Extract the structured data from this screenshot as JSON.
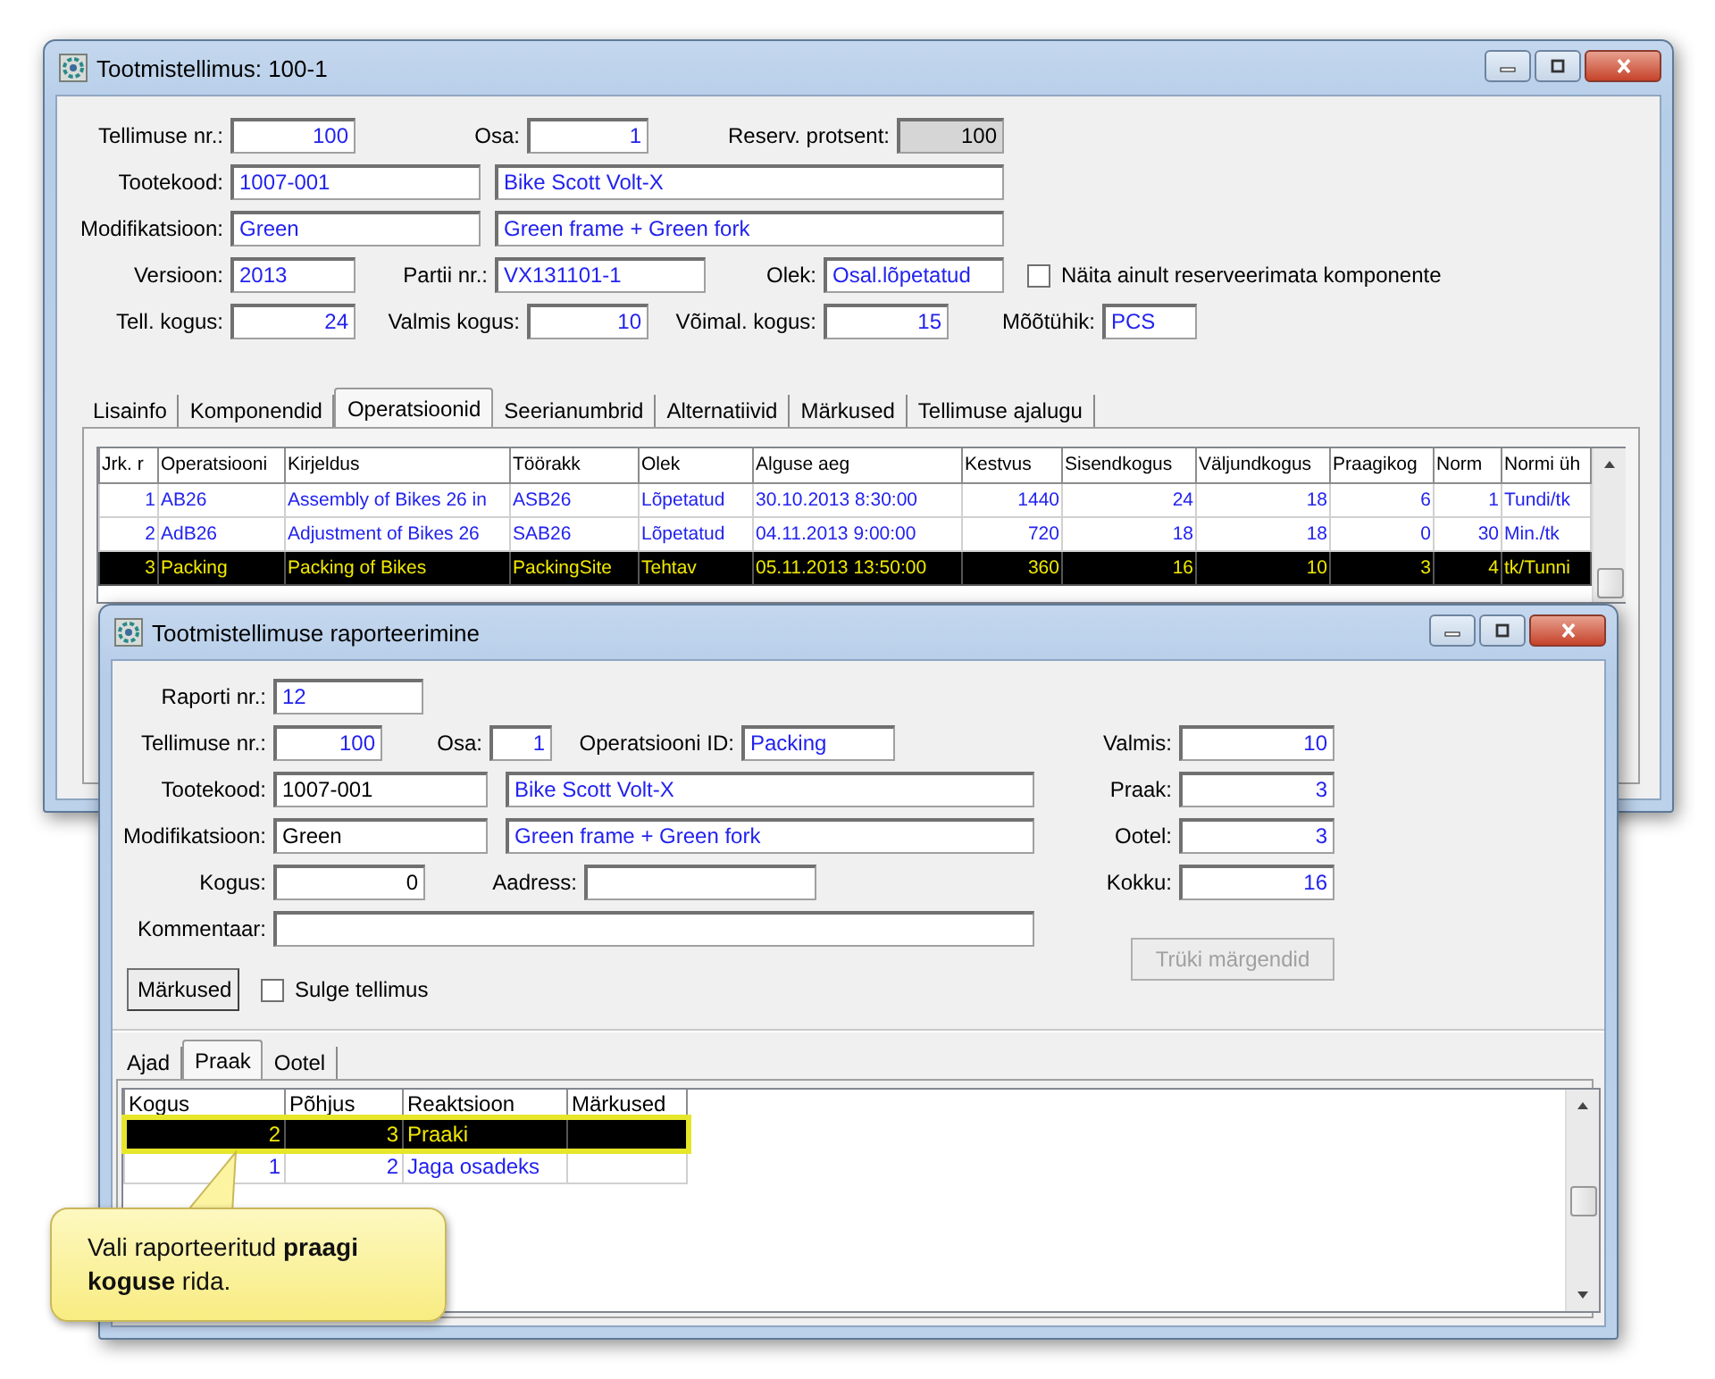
{
  "main_window": {
    "title": "Tootmistellimus: 100-1",
    "fields": [
      {
        "label": "Tellimuse nr.:",
        "value": "100",
        "kind": "lookup"
      },
      {
        "label": "Osa:",
        "value": "1",
        "kind": "lookup"
      },
      {
        "label": "Reserv. protsent:",
        "value": "100",
        "kind": "readonly"
      },
      {
        "label": "Tootekood:",
        "value": "1007-001",
        "kind": "lookup"
      },
      {
        "value": "Bike Scott Volt-X",
        "kind": "lookup"
      },
      {
        "label": "Modifikatsioon:",
        "value": "Green",
        "kind": "lookup"
      },
      {
        "value": "Green frame + Green fork",
        "kind": "lookup"
      },
      {
        "label": "Versioon:",
        "value": "2013",
        "kind": "lookup"
      },
      {
        "label": "Partii nr.:",
        "value": "VX131101-1",
        "kind": "lookup"
      },
      {
        "label": "Olek:",
        "value": "Osal.lõpetatud",
        "kind": "lookup"
      },
      {
        "label": "Tell. kogus:",
        "value": "24",
        "kind": "lookup"
      },
      {
        "label": "Valmis kogus:",
        "value": "10",
        "kind": "lookup"
      },
      {
        "label": "Võimal. kogus:",
        "value": "15",
        "kind": "lookup"
      },
      {
        "label": "Mõõtühik:",
        "value": "PCS",
        "kind": "lookup"
      }
    ],
    "checkbox": {
      "label": "Näita ainult reserveerimata komponente",
      "checked": false
    },
    "tabs": [
      {
        "label": "Lisainfo",
        "selected": false
      },
      {
        "label": "Komponendid",
        "selected": false
      },
      {
        "label": "Operatsioonid",
        "selected": true
      },
      {
        "label": "Seerianumbrid",
        "selected": false
      },
      {
        "label": "Alternatiivid",
        "selected": false
      },
      {
        "label": "Märkused",
        "selected": false
      },
      {
        "label": "Tellimuse ajalugu",
        "selected": false
      }
    ],
    "table": {
      "columns": [
        "Jrk. r",
        "Operatsiooni",
        "Kirjeldus",
        "Töörakk",
        "Olek",
        "Alguse aeg",
        "Kestvus",
        "Sisendkogus",
        "Väljundkogus",
        "Praagikog",
        "Norm",
        "Normi üh"
      ],
      "rows": [
        {
          "cells": [
            "1",
            "AB26",
            "Assembly of Bikes 26 in",
            "ASB26",
            "Lõpetatud",
            "30.10.2013 8:30:00",
            "1440",
            "24",
            "18",
            "6",
            "1",
            "Tundi/tk"
          ],
          "selected": false
        },
        {
          "cells": [
            "2",
            "AdB26",
            "Adjustment of Bikes 26",
            "SAB26",
            "Lõpetatud",
            "04.11.2013 9:00:00",
            "720",
            "18",
            "18",
            "0",
            "30",
            "Min./tk"
          ],
          "selected": false
        },
        {
          "cells": [
            "3",
            "Packing",
            "Packing of Bikes",
            "PackingSite",
            "Tehtav",
            "05.11.2013 13:50:00",
            "360",
            "16",
            "10",
            "3",
            "4",
            "tk/Tunni"
          ],
          "selected": true
        }
      ]
    }
  },
  "report_window": {
    "title": "Tootmistellimuse raporteerimine",
    "fields": [
      {
        "label": "Raporti nr.:",
        "value": "12",
        "kind": "lookup"
      },
      {
        "label": "Tellimuse nr.:",
        "value": "100",
        "kind": "lookup"
      },
      {
        "label": "Osa:",
        "value": "1",
        "kind": "lookup"
      },
      {
        "label": "Operatsiooni ID:",
        "value": "Packing",
        "kind": "lookup"
      },
      {
        "label": "Tootekood:",
        "value": "1007-001",
        "kind": "plain"
      },
      {
        "value": "Bike Scott Volt-X",
        "kind": "lookup"
      },
      {
        "label": "Modifikatsioon:",
        "value": "Green",
        "kind": "plain"
      },
      {
        "value": "Green frame + Green fork",
        "kind": "lookup"
      },
      {
        "label": "Kogus:",
        "value": "0",
        "kind": "plain"
      },
      {
        "label": "Aadress:",
        "kind": "plain"
      },
      {
        "label": "Kommentaar:",
        "kind": "plain"
      },
      {
        "label": "Valmis:",
        "value": "10",
        "kind": "lookup"
      },
      {
        "label": "Praak:",
        "value": "3",
        "kind": "lookup"
      },
      {
        "label": "Ootel:",
        "value": "3",
        "kind": "lookup"
      },
      {
        "label": "Kokku:",
        "value": "16",
        "kind": "lookup"
      }
    ],
    "notes_button": "Märkused",
    "checkbox": {
      "label": "Sulge tellimus",
      "checked": false
    },
    "print_button": {
      "label": "Trüki märgendid",
      "disabled": true
    },
    "tabs": [
      {
        "label": "Ajad",
        "selected": false
      },
      {
        "label": "Praak",
        "selected": true
      },
      {
        "label": "Ootel",
        "selected": false
      }
    ],
    "table": {
      "columns": [
        "Kogus",
        "Põhjus",
        "Reaktsioon",
        "Märkused"
      ],
      "rows": [
        {
          "cells": [
            "2",
            "3",
            "Praaki",
            ""
          ],
          "selected": true
        },
        {
          "cells": [
            "1",
            "2",
            "Jaga osadeks",
            ""
          ],
          "selected": false
        }
      ]
    }
  },
  "callout": {
    "text": "Vali raporteeritud **praagi koguse** rida."
  }
}
